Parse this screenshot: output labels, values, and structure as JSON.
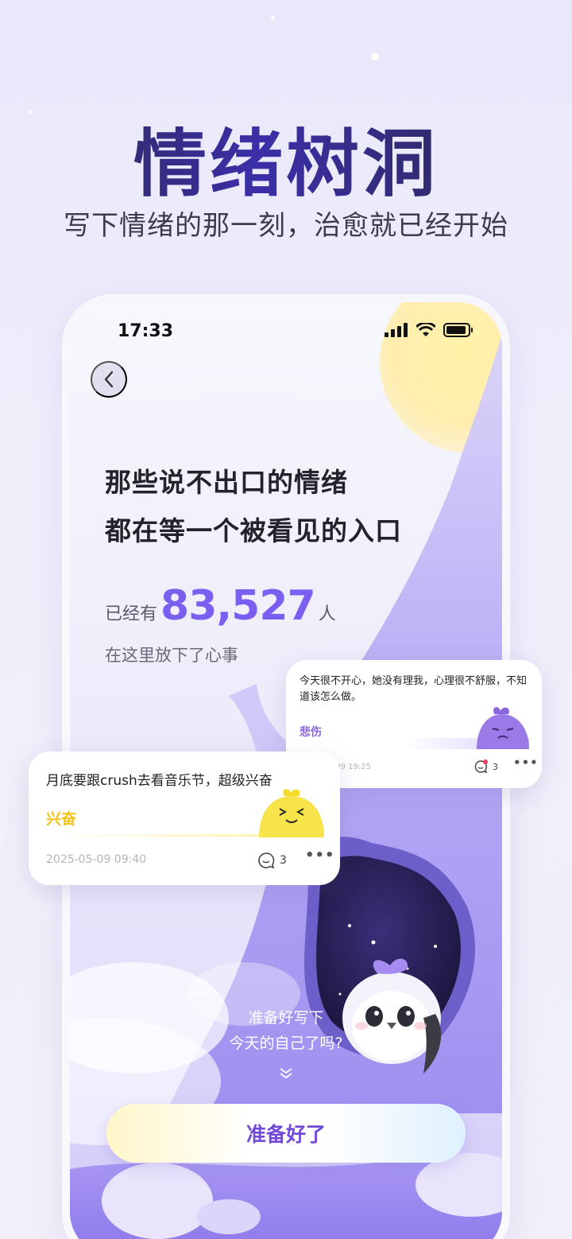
{
  "hero": {
    "title": "情绪树洞",
    "subtitle": "写下情绪的那一刻，治愈就已经开始"
  },
  "status_bar": {
    "time": "17:33",
    "icons": [
      "signal-icon",
      "wifi-icon",
      "battery-icon"
    ]
  },
  "nav": {
    "back_icon": "chevron-left-icon"
  },
  "main": {
    "headline_line1": "那些说不出口的情绪",
    "headline_line2": "都在等一个被看见的入口",
    "stats_prefix": "已经有",
    "stats_number": "83,527",
    "stats_suffix": "人",
    "stats_caption": "在这里放下了心事",
    "prompt_line1": "准备好写下",
    "prompt_line2": "今天的自己了吗?",
    "cta_label": "准备好了"
  },
  "cards": [
    {
      "text": "月底要跟crush去看音乐节，超级兴奋",
      "mood": "兴奋",
      "date": "2025-05-09 09:40",
      "comment_count": "3",
      "mood_color": "#f2c318"
    },
    {
      "text": "今天很不开心，她没有理我，心理很不舒服，不知道该怎么做。",
      "mood": "悲伤",
      "date": "2025-05-09 19:25",
      "comment_count": "3",
      "mood_color": "#8a66e0"
    }
  ],
  "colors": {
    "accent": "#7b5ff0",
    "cta_text": "#7249d8",
    "tree": "#b8aef6",
    "moon": "#fff2a8"
  }
}
